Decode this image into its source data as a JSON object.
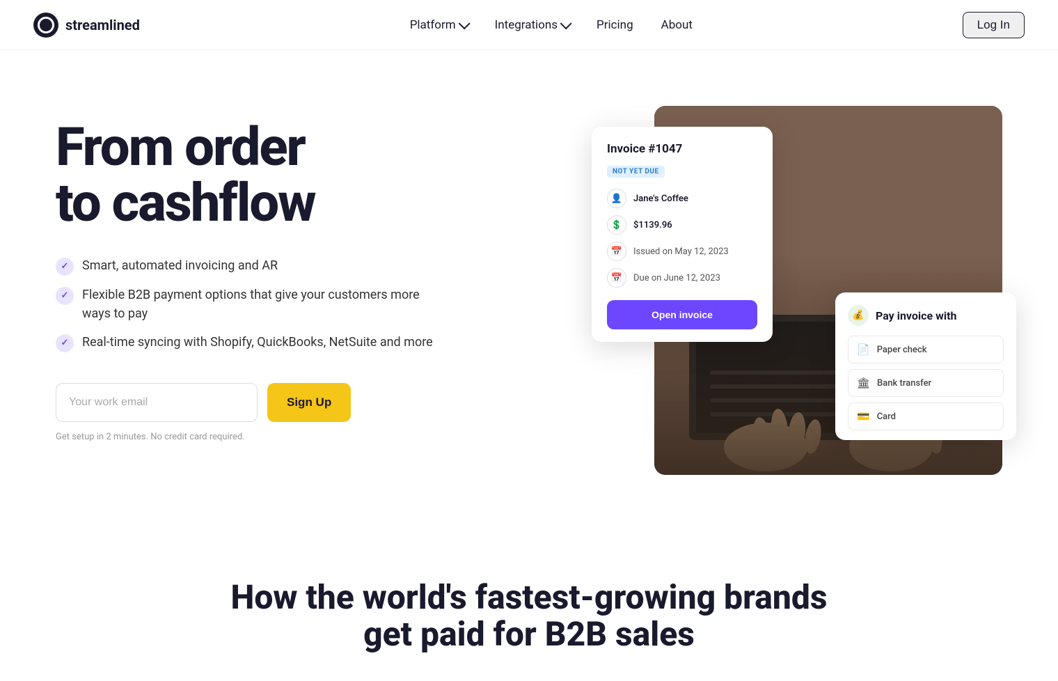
{
  "brand": {
    "name": "streamlined",
    "logo_alt": "Streamlined logo"
  },
  "nav": {
    "platform_label": "Platform",
    "integrations_label": "Integrations",
    "pricing_label": "Pricing",
    "about_label": "About",
    "login_label": "Log In"
  },
  "hero": {
    "heading_line1": "From order",
    "heading_line2": "to cashflow",
    "features": [
      {
        "text": "Smart, automated invoicing and AR"
      },
      {
        "text": "Flexible B2B payment options that give your customers more ways to pay"
      },
      {
        "text": "Real-time syncing with Shopify, QuickBooks, NetSuite and more"
      }
    ],
    "email_placeholder": "Your work email",
    "signup_label": "Sign Up",
    "note": "Get setup in 2 minutes. No credit card required."
  },
  "invoice_card": {
    "title": "Invoice #1047",
    "badge": "NOT YET DUE",
    "client": "Jane's Coffee",
    "amount": "$1139.96",
    "issued": "Issued on May 12, 2023",
    "due": "Due on June 12, 2023",
    "open_btn": "Open invoice"
  },
  "pay_card": {
    "title": "Pay invoice with",
    "title_icon": "💰",
    "options": [
      {
        "icon": "📄",
        "label": "Paper check"
      },
      {
        "icon": "🏛",
        "label": "Bank transfer"
      },
      {
        "icon": "💳",
        "label": "Card"
      }
    ]
  },
  "bottom": {
    "heading_line1": "How the world's fastest-growing brands",
    "heading_line2": "get paid for B2B sales"
  }
}
